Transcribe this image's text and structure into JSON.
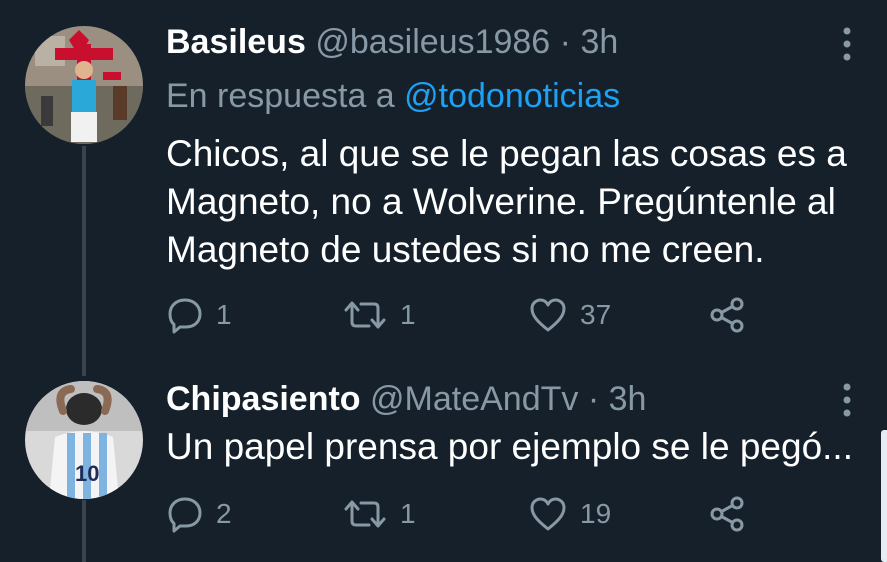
{
  "tweets": [
    {
      "name": "Basileus",
      "handle": "@basileus1986",
      "separator": "·",
      "time": "3h",
      "reply_prefix": "En respuesta a ",
      "reply_mention": "@todonoticias",
      "text": "Chicos, al que se le pegan las cosas es a Magneto, no a Wolverine. Pregúntenle al Magneto de ustedes si no me creen.",
      "replies": "1",
      "retweets": "1",
      "likes": "37"
    },
    {
      "name": "Chipasiento",
      "handle": "@MateAndTv",
      "separator": "·",
      "time": "3h",
      "text": "Un papel prensa por ejemplo se le pegó...",
      "replies": "2",
      "retweets": "1",
      "likes": "19"
    }
  ],
  "colors": {
    "background": "#15202b",
    "secondary_text": "#8899a6",
    "link": "#1da1f2",
    "thread_line": "#38444d"
  },
  "icons": [
    "reply-icon",
    "retweet-icon",
    "like-icon",
    "share-icon",
    "more-options-icon"
  ]
}
